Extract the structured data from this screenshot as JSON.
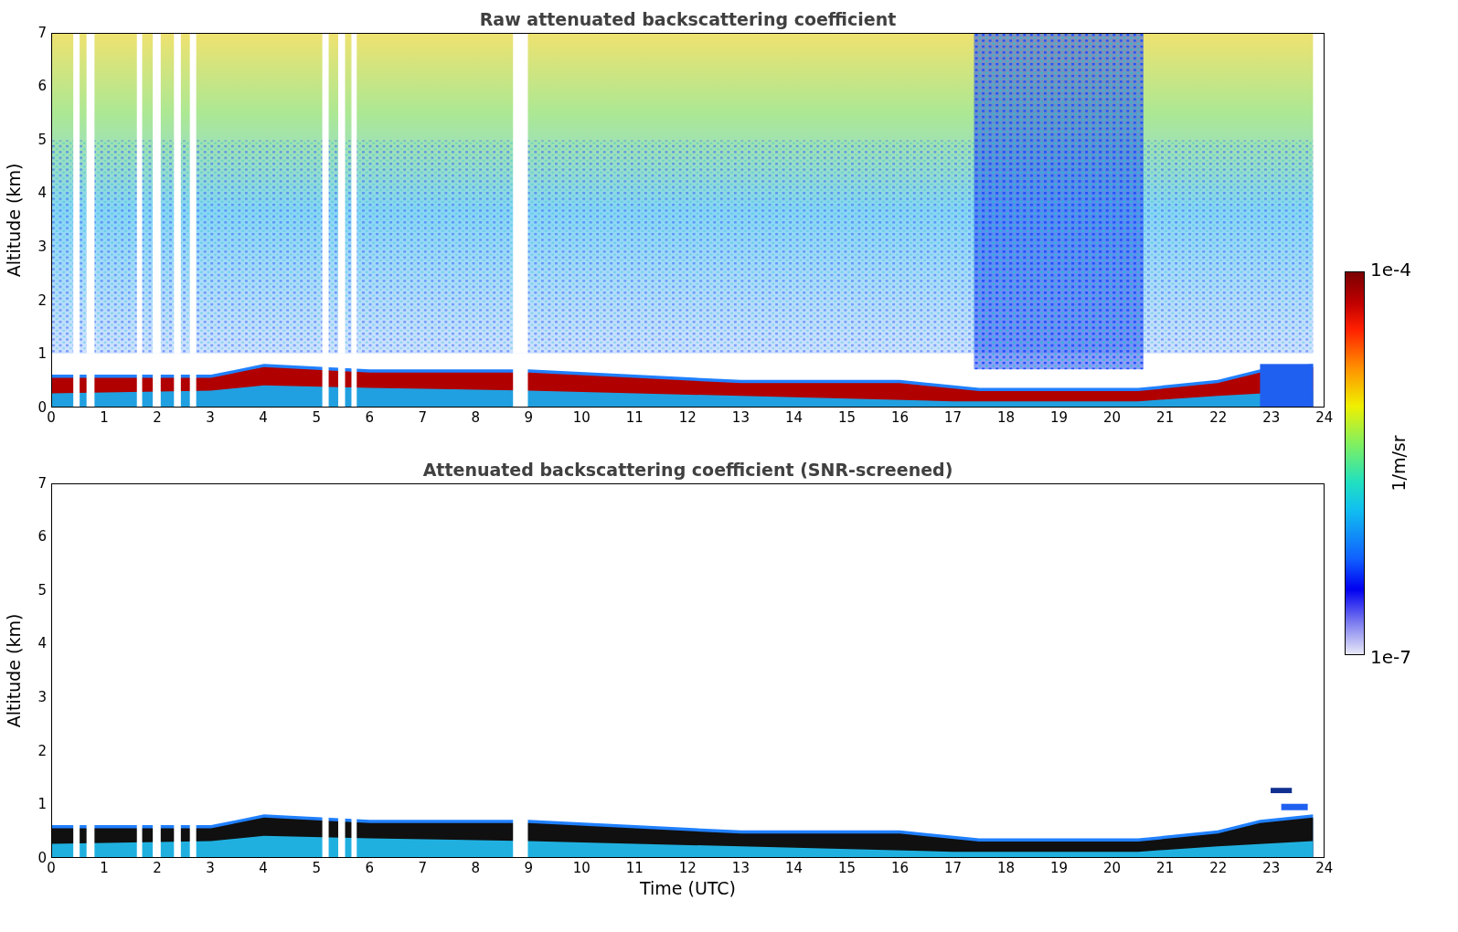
{
  "panels": [
    {
      "kind": "raw",
      "title": "Raw attenuated backscattering coefficient",
      "ylabel": "Altitude (km)",
      "yticks": [
        "7",
        "6",
        "5",
        "4",
        "3",
        "2",
        "1",
        "0"
      ],
      "xticks": [
        "0",
        "1",
        "2",
        "3",
        "4",
        "5",
        "6",
        "7",
        "8",
        "9",
        "10",
        "11",
        "12",
        "13",
        "14",
        "15",
        "16",
        "17",
        "18",
        "19",
        "20",
        "21",
        "22",
        "23",
        "24"
      ]
    },
    {
      "kind": "screened",
      "title": "Attenuated backscattering coefficient (SNR-screened)",
      "ylabel": "Altitude (km)",
      "yticks": [
        "7",
        "6",
        "5",
        "4",
        "3",
        "2",
        "1",
        "0"
      ],
      "xticks": [
        "0",
        "1",
        "2",
        "3",
        "4",
        "5",
        "6",
        "7",
        "8",
        "9",
        "10",
        "11",
        "12",
        "13",
        "14",
        "15",
        "16",
        "17",
        "18",
        "19",
        "20",
        "21",
        "22",
        "23",
        "24"
      ],
      "xlabel": "Time (UTC)"
    }
  ],
  "colorbar": {
    "max_label": "1e-4",
    "min_label": "1e-7",
    "unit": "1/m/sr"
  }
}
